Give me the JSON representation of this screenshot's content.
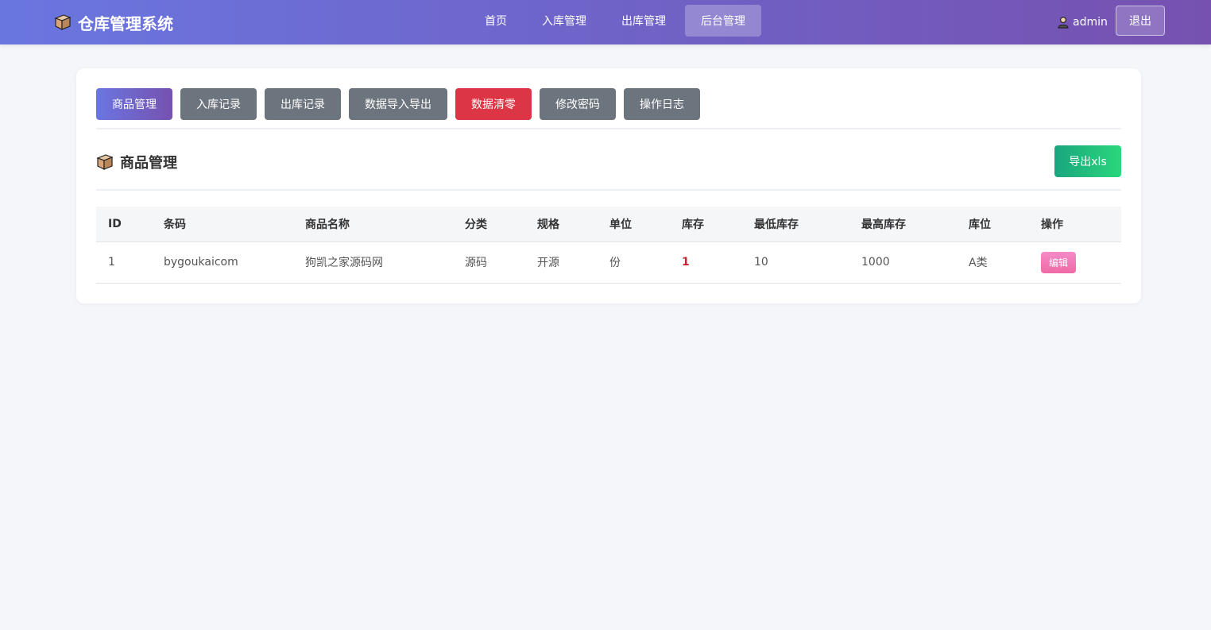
{
  "app": {
    "title": "仓库管理系统",
    "logo_icon": "package-icon"
  },
  "nav": {
    "items": [
      {
        "label": "首页"
      },
      {
        "label": "入库管理"
      },
      {
        "label": "出库管理"
      },
      {
        "label": "后台管理",
        "active": true
      }
    ]
  },
  "user": {
    "name": "admin",
    "icon": "user-icon",
    "logout_label": "退出"
  },
  "tabs": [
    {
      "label": "商品管理",
      "style": "primary"
    },
    {
      "label": "入库记录",
      "style": "secondary"
    },
    {
      "label": "出库记录",
      "style": "secondary"
    },
    {
      "label": "数据导入导出",
      "style": "secondary"
    },
    {
      "label": "数据清零",
      "style": "danger"
    },
    {
      "label": "修改密码",
      "style": "secondary"
    },
    {
      "label": "操作日志",
      "style": "secondary"
    }
  ],
  "section": {
    "title": "商品管理",
    "icon": "package-icon",
    "export_label": "导出xls"
  },
  "table": {
    "headers": [
      "ID",
      "条码",
      "商品名称",
      "分类",
      "规格",
      "单位",
      "库存",
      "最低库存",
      "最高库存",
      "库位",
      "操作"
    ],
    "rows": [
      {
        "id": "1",
        "barcode": "bygoukaicom",
        "name": "狗凯之家源码网",
        "category": "源码",
        "spec": "开源",
        "unit": "份",
        "stock": "1",
        "min_stock": "10",
        "max_stock": "1000",
        "location": "A类",
        "action_label": "编辑"
      }
    ]
  },
  "colors": {
    "header_gradient": [
      "#6a76e0",
      "#7651b0"
    ],
    "danger": "#dc3545",
    "secondary": "#6c757d",
    "export": "#2ad77c",
    "edit": "#f06aa5",
    "stock_low": "#c82333"
  }
}
